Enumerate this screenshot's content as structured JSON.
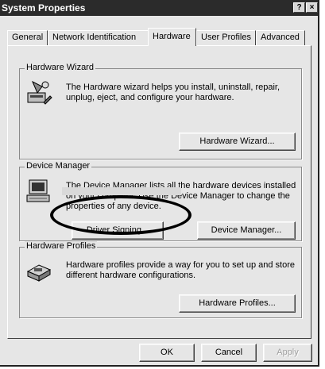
{
  "window": {
    "title": "System Properties",
    "help_button": "?",
    "close_button": "×"
  },
  "tabs": [
    {
      "label": "General"
    },
    {
      "label": "Network Identification"
    },
    {
      "label": "Hardware"
    },
    {
      "label": "User Profiles"
    },
    {
      "label": "Advanced"
    }
  ],
  "hardware_wizard": {
    "title": "Hardware Wizard",
    "description": "The Hardware wizard helps you install, uninstall, repair,\nunplug, eject, and configure your hardware.",
    "button": "Hardware Wizard..."
  },
  "device_manager": {
    "title": "Device Manager",
    "description": "The Device Manager lists all the hardware devices installed\non your computer. Use the Device Manager to change the\nproperties of any device.",
    "driver_signing_button": "Driver Signing...",
    "device_manager_button": "Device Manager..."
  },
  "hardware_profiles": {
    "title": "Hardware Profiles",
    "description": "Hardware profiles provide a way for you to set up and store\ndifferent hardware configurations.",
    "button": "Hardware Profiles..."
  },
  "footer": {
    "ok": "OK",
    "cancel": "Cancel",
    "apply": "Apply"
  }
}
